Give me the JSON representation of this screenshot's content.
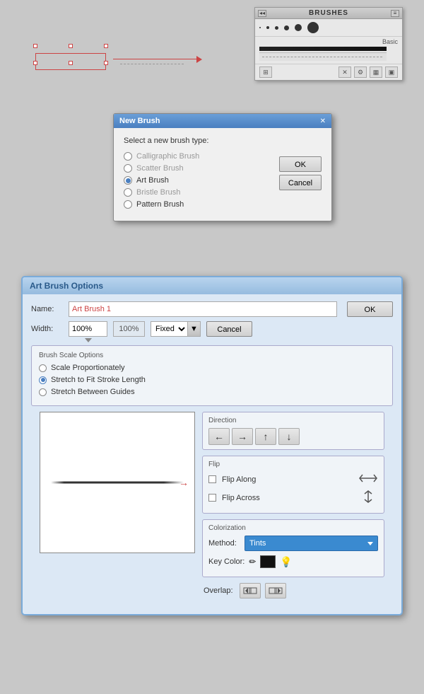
{
  "brushes_panel": {
    "title": "BRUSHES",
    "basic_label": "Basic",
    "dots": [
      "tiny",
      "small",
      "medium",
      "large",
      "xlarge",
      "circle"
    ]
  },
  "new_brush_dialog": {
    "title": "New Brush",
    "prompt": "Select a new brush type:",
    "options": [
      {
        "label": "Calligraphic Brush",
        "selected": false,
        "enabled": false
      },
      {
        "label": "Scatter Brush",
        "selected": false,
        "enabled": false
      },
      {
        "label": "Art Brush",
        "selected": true,
        "enabled": true
      },
      {
        "label": "Bristle Brush",
        "selected": false,
        "enabled": false
      },
      {
        "label": "Pattern Brush",
        "selected": false,
        "enabled": true
      }
    ],
    "ok_label": "OK",
    "cancel_label": "Cancel"
  },
  "art_brush_dialog": {
    "title": "Art Brush Options",
    "name_label": "Name:",
    "name_value": "Art Brush 1",
    "width_label": "Width:",
    "width_value": "100%",
    "width_display": "100%",
    "fixed_label": "Fixed",
    "ok_label": "OK",
    "cancel_label": "Cancel",
    "scale_options": {
      "title": "Brush Scale Options",
      "options": [
        {
          "label": "Scale Proportionately",
          "selected": false
        },
        {
          "label": "Stretch to Fit Stroke Length",
          "selected": true
        },
        {
          "label": "Stretch Between Guides",
          "selected": false
        }
      ]
    },
    "direction": {
      "title": "Direction",
      "buttons": [
        "←",
        "→",
        "↑",
        "↓"
      ]
    },
    "flip": {
      "title": "Flip",
      "flip_along_label": "Flip Along",
      "flip_across_label": "Flip Across"
    },
    "colorization": {
      "title": "Colorization",
      "method_label": "Method:",
      "method_value": "Tints",
      "key_color_label": "Key Color:"
    },
    "overlap": {
      "label": "Overlap:"
    }
  }
}
